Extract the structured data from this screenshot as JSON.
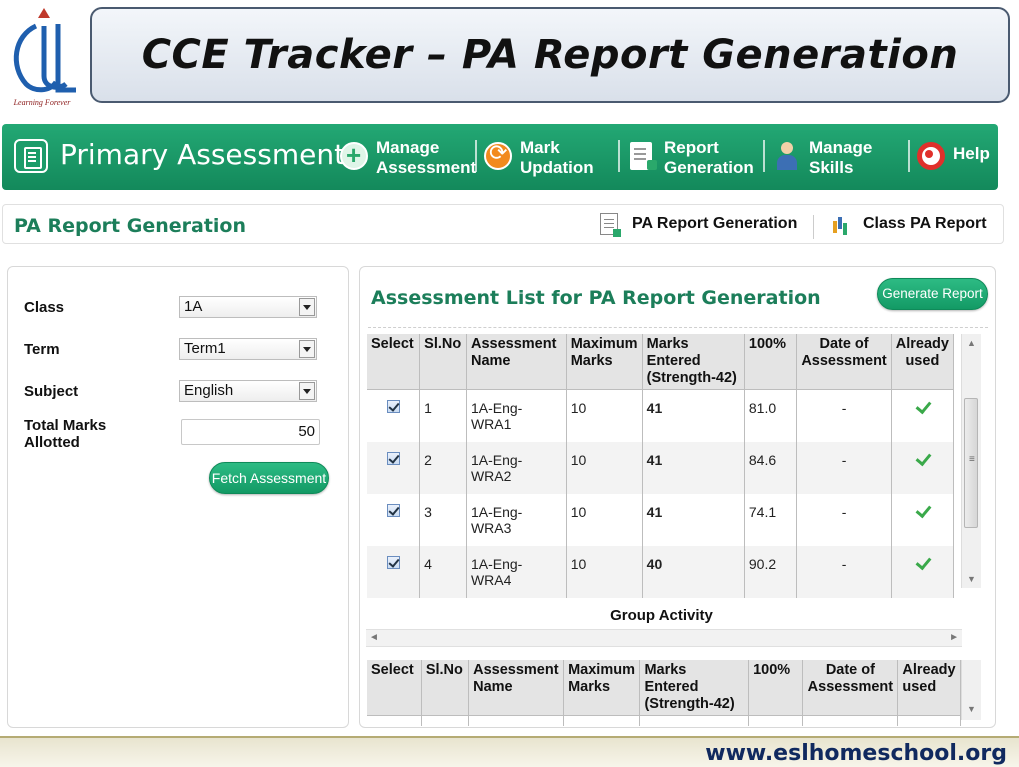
{
  "slide": {
    "title": "CCE Tracker – PA Report Generation",
    "logo_tagline": "Learning Forever",
    "footer_url": "www.eslhomeschool.org"
  },
  "nav": {
    "title": "Primary Assessment",
    "items": [
      {
        "line1": "Manage",
        "line2": "Assessment",
        "icon": "add-icon"
      },
      {
        "line1": "Mark",
        "line2": "Updation",
        "icon": "refresh-icon"
      },
      {
        "line1": "Report",
        "line2": "Generation",
        "icon": "report-icon"
      },
      {
        "line1": "Manage",
        "line2": "Skills",
        "icon": "person-icon"
      },
      {
        "line1": "Help",
        "line2": "",
        "icon": "lifebuoy-icon"
      }
    ]
  },
  "subheader": {
    "page_title": "PA Report Generation",
    "link_pa_report": "PA Report Generation",
    "link_class_report": "Class PA Report"
  },
  "filters": {
    "class_label": "Class",
    "class_value": "1A",
    "term_label": "Term",
    "term_value": "Term1",
    "subject_label": "Subject",
    "subject_value": "English",
    "total_label_line1": "Total Marks",
    "total_label_line2": "Allotted",
    "total_value": "50",
    "fetch_button": "Fetch Assessment"
  },
  "assessment_list": {
    "title": "Assessment List for PA Report Generation",
    "generate_button": "Generate Report",
    "headers": {
      "select": "Select",
      "slno": "Sl.No",
      "name_l1": "Assessment",
      "name_l2": "Name",
      "max_l1": "Maximum",
      "max_l2": "Marks",
      "entered_l1": "Marks Entered",
      "entered_l2": "(Strength-42)",
      "pct": "100%",
      "date_l1": "Date of",
      "date_l2": "Assessment",
      "used_l1": "Already",
      "used_l2": "used"
    },
    "rows": [
      {
        "slno": "1",
        "name": "1A-Eng-WRA1",
        "max": "10",
        "entered": "41",
        "pct": "81.0",
        "date": "-",
        "selected": true,
        "used": true
      },
      {
        "slno": "2",
        "name": "1A-Eng-WRA2",
        "max": "10",
        "entered": "41",
        "pct": "84.6",
        "date": "-",
        "selected": true,
        "used": true
      },
      {
        "slno": "3",
        "name": "1A-Eng-WRA3",
        "max": "10",
        "entered": "41",
        "pct": "74.1",
        "date": "-",
        "selected": true,
        "used": true
      },
      {
        "slno": "4",
        "name": "1A-Eng-WRA4",
        "max": "10",
        "entered": "40",
        "pct": "90.2",
        "date": "-",
        "selected": true,
        "used": true
      }
    ]
  },
  "group_activity": {
    "label": "Group Activity"
  },
  "colors": {
    "brand_green": "#1a9a68",
    "heading_green": "#1c7e5a",
    "marks_red": "#cc1f1f",
    "footer_navy": "#10295f"
  }
}
